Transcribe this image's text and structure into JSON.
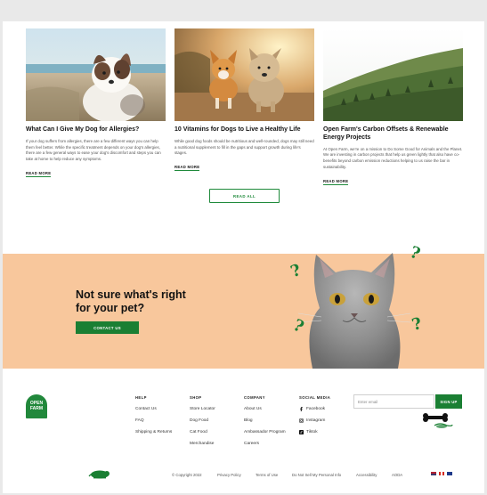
{
  "posts": [
    {
      "title": "What Can I Give My Dog for Allergies?",
      "excerpt": "If your dog suffers from allergies, there are a few different ways you can help them feel better. While the specific treatment depends on your dog's allergies, there are a few general ways to ease your dog's discomfort and steps you can take at home to help reduce any symptoms.",
      "link": "READ MORE"
    },
    {
      "title": "10 Vitamins for Dogs to Live a Healthy Life",
      "excerpt": "While good dog foods should be nutritious and well-rounded, dogs may still need a nutritional supplement to fill in the gaps and support growth during life's stages.",
      "link": "READ MORE"
    },
    {
      "title": "Open Farm's Carbon Offsets & Renewable Energy Projects",
      "excerpt": "At Open Farm, we're on a mission to Do Some Good for Animals and the Planet. We are investing in carbon projects that help us green lightly that also have co-benefits beyond carbon emission reductions helping to us raise the bar in sustainability.",
      "link": "READ MORE"
    }
  ],
  "read_all": "READ ALL",
  "promo": {
    "title": "Not sure what's right\nfor your pet?",
    "button": "CONTACT US"
  },
  "logo": {
    "line1": "OPEN",
    "line2": "FARM"
  },
  "footer": {
    "help": {
      "heading": "HELP",
      "items": [
        "Contact Us",
        "FAQ",
        "Shipping & Returns"
      ]
    },
    "shop": {
      "heading": "SHOP",
      "items": [
        "Store Locator",
        "Dog Food",
        "Cat Food",
        "Merchandise"
      ]
    },
    "company": {
      "heading": "COMPANY",
      "items": [
        "About Us",
        "Blog",
        "Ambassador Program",
        "Careers"
      ]
    },
    "social": {
      "heading": "SOCIAL MEDIA",
      "items": [
        "Facebook",
        "Instagram",
        "Tiktok"
      ]
    }
  },
  "newsletter": {
    "placeholder": "Enter email",
    "button": "SIGN UP"
  },
  "bottom": {
    "copyright": "© Copyright 2022",
    "links": [
      "Privacy Policy",
      "Terms of Use",
      "Do Not Sell My Personal Info",
      "Accessibility",
      "AODA"
    ]
  },
  "colors": {
    "brand_green": "#1a7f33",
    "promo_bg": "#f8c79c"
  }
}
